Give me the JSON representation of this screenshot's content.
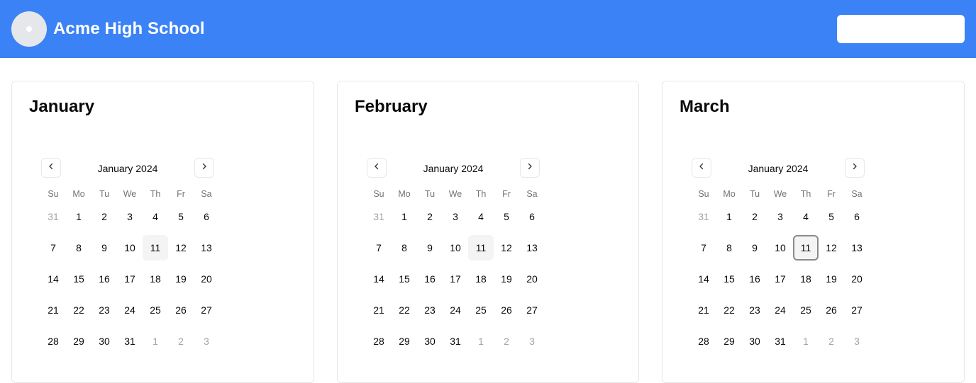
{
  "header": {
    "school_name": "Acme High School",
    "search_value": ""
  },
  "colors": {
    "header_bg": "#3b82f6",
    "accent": "#3b82f6"
  },
  "cards": [
    {
      "title": "January",
      "calendar": {
        "caption": "January 2024",
        "focused_today": false
      }
    },
    {
      "title": "February",
      "calendar": {
        "caption": "January 2024",
        "focused_today": false
      }
    },
    {
      "title": "March",
      "calendar": {
        "caption": "January 2024",
        "focused_today": true
      }
    }
  ],
  "weekdays": [
    "Su",
    "Mo",
    "Tu",
    "We",
    "Th",
    "Fr",
    "Sa"
  ],
  "weeks": [
    [
      "31",
      "1",
      "2",
      "3",
      "4",
      "5",
      "6"
    ],
    [
      "7",
      "8",
      "9",
      "10",
      "11",
      "12",
      "13"
    ],
    [
      "14",
      "15",
      "16",
      "17",
      "18",
      "19",
      "20"
    ],
    [
      "21",
      "22",
      "23",
      "24",
      "25",
      "26",
      "27"
    ],
    [
      "28",
      "29",
      "30",
      "31",
      "1",
      "2",
      "3"
    ]
  ],
  "outside_days": [
    [
      0,
      0
    ],
    [
      4,
      4
    ],
    [
      4,
      5
    ],
    [
      4,
      6
    ]
  ],
  "today": [
    1,
    4
  ],
  "icons": {
    "prev": "chevron-left-icon",
    "next": "chevron-right-icon"
  }
}
